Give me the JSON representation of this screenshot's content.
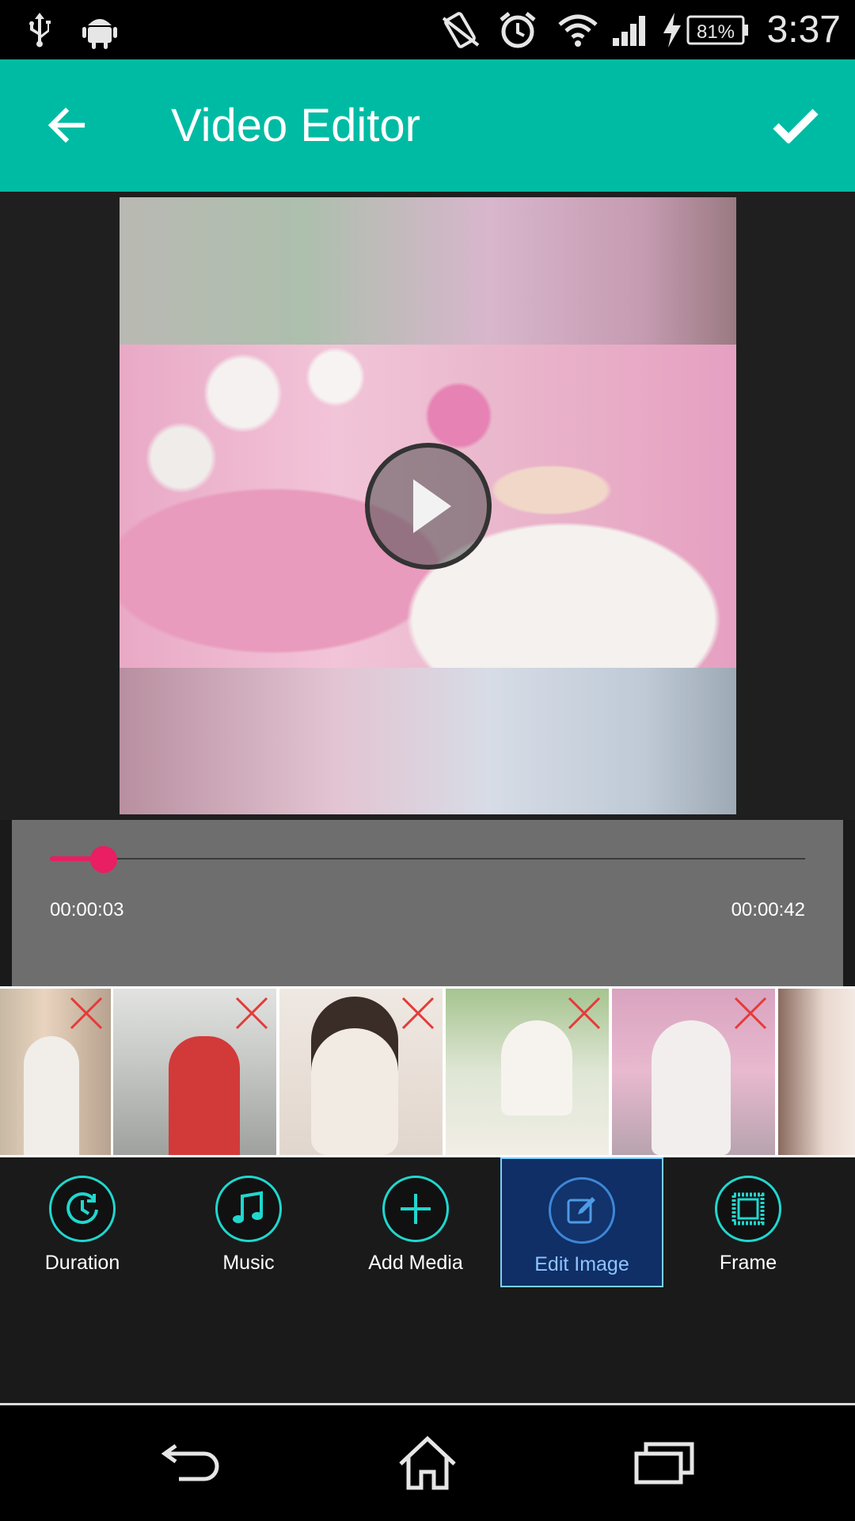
{
  "status_bar": {
    "battery_percent": "81%",
    "time": "3:37",
    "icons": [
      "usb-icon",
      "android-icon",
      "vibrate-icon",
      "alarm-icon",
      "wifi-icon",
      "signal-icon",
      "charging-icon",
      "battery-icon"
    ]
  },
  "app_bar": {
    "title": "Video Editor",
    "back_icon": "arrow-left-icon",
    "done_icon": "check-icon"
  },
  "preview": {
    "play_icon": "play-icon"
  },
  "timeline": {
    "current_time": "00:00:03",
    "total_time": "00:00:42",
    "progress_fraction": 0.0714
  },
  "filmstrip": {
    "items": [
      {
        "remove_icon": "close-icon"
      },
      {
        "remove_icon": "close-icon"
      },
      {
        "remove_icon": "close-icon"
      },
      {
        "remove_icon": "close-icon"
      },
      {
        "remove_icon": "close-icon"
      },
      {
        "remove_icon": ""
      }
    ]
  },
  "toolbar": {
    "items": [
      {
        "label": "Duration",
        "icon": "clock-icon",
        "active": false
      },
      {
        "label": "Music",
        "icon": "music-note-icon",
        "active": false
      },
      {
        "label": "Add Media",
        "icon": "plus-icon",
        "active": false
      },
      {
        "label": "Edit Image",
        "icon": "edit-icon",
        "active": true
      },
      {
        "label": "Frame",
        "icon": "frame-icon",
        "active": false
      }
    ]
  },
  "nav_bar": {
    "icons": [
      "back-nav-icon",
      "home-icon",
      "recents-icon"
    ]
  },
  "colors": {
    "accent": "#00bba3",
    "progress": "#e91e63",
    "tool_ring": "#20d7ce",
    "active_bg": "#0f2f66"
  }
}
